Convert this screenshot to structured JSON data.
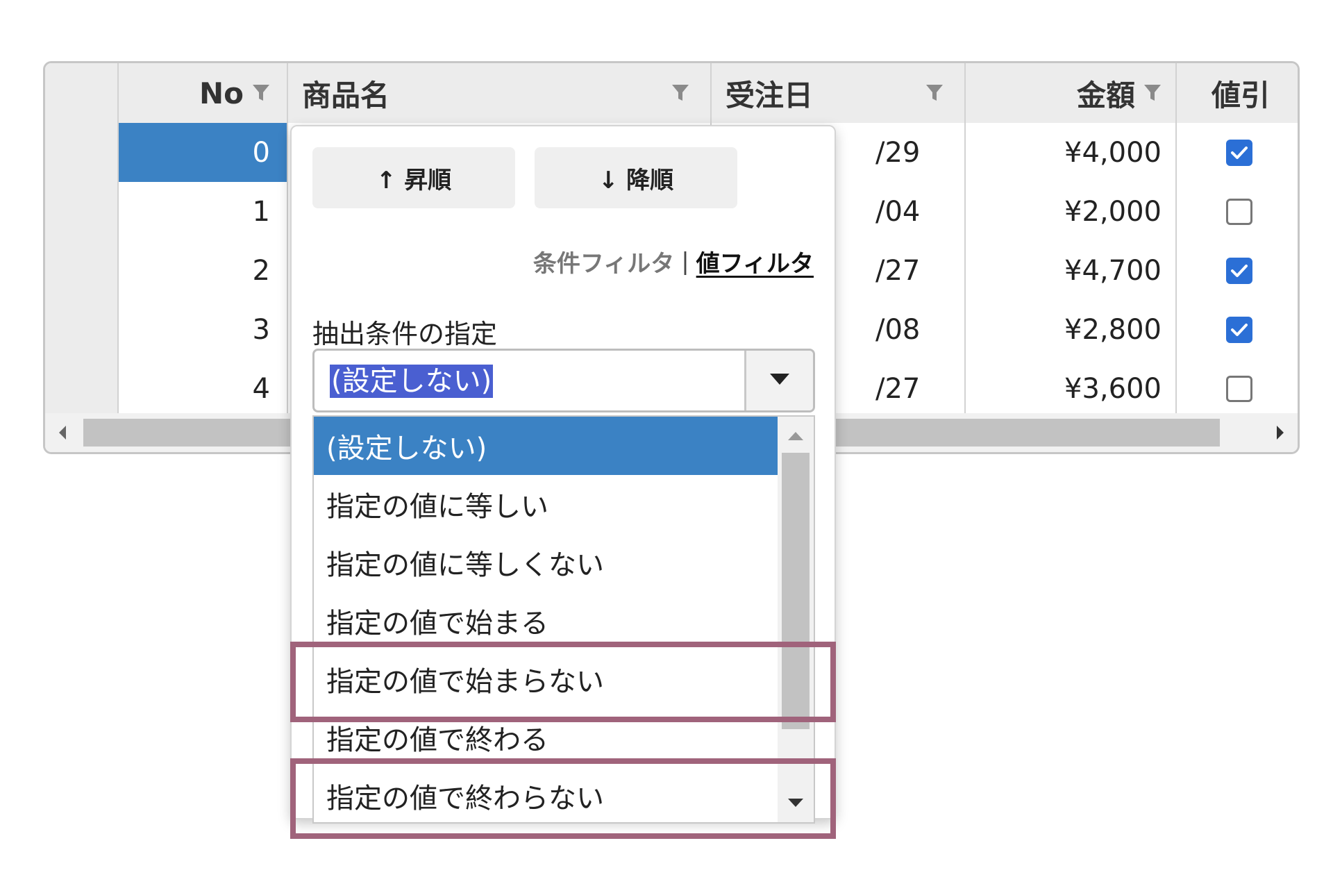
{
  "grid": {
    "columns": {
      "no": "No",
      "name": "商品名",
      "date": "受注日",
      "amount": "金額",
      "discount": "値引"
    },
    "rows": [
      {
        "no": "0",
        "date_tail": "/29",
        "amount": "¥4,000",
        "discount": true
      },
      {
        "no": "1",
        "date_tail": "/04",
        "amount": "¥2,000",
        "discount": false
      },
      {
        "no": "2",
        "date_tail": "/27",
        "amount": "¥4,700",
        "discount": true
      },
      {
        "no": "3",
        "date_tail": "/08",
        "amount": "¥2,800",
        "discount": true
      },
      {
        "no": "4",
        "date_tail": "/27",
        "amount": "¥3,600",
        "discount": false
      }
    ],
    "selected_row": 0
  },
  "filter_popup": {
    "sort_asc": "↑ 昇順",
    "sort_desc": "↓ 降順",
    "mode_condition": "条件フィルタ",
    "mode_separator": "|",
    "mode_value": "値フィルタ",
    "condition_label": "抽出条件の指定",
    "combo_value": "(設定しない)",
    "options": [
      "(設定しない)",
      "指定の値に等しい",
      "指定の値に等しくない",
      "指定の値で始まる",
      "指定の値で始まらない",
      "指定の値で終わる",
      "指定の値で終わらない"
    ],
    "active_option": 0,
    "highlighted_options": [
      4,
      6
    ]
  },
  "colors": {
    "selection": "#3b82c4",
    "checkbox_on": "#2b6fd6",
    "highlight_frame": "#a0637b",
    "combo_selection": "#4a5fd1"
  }
}
